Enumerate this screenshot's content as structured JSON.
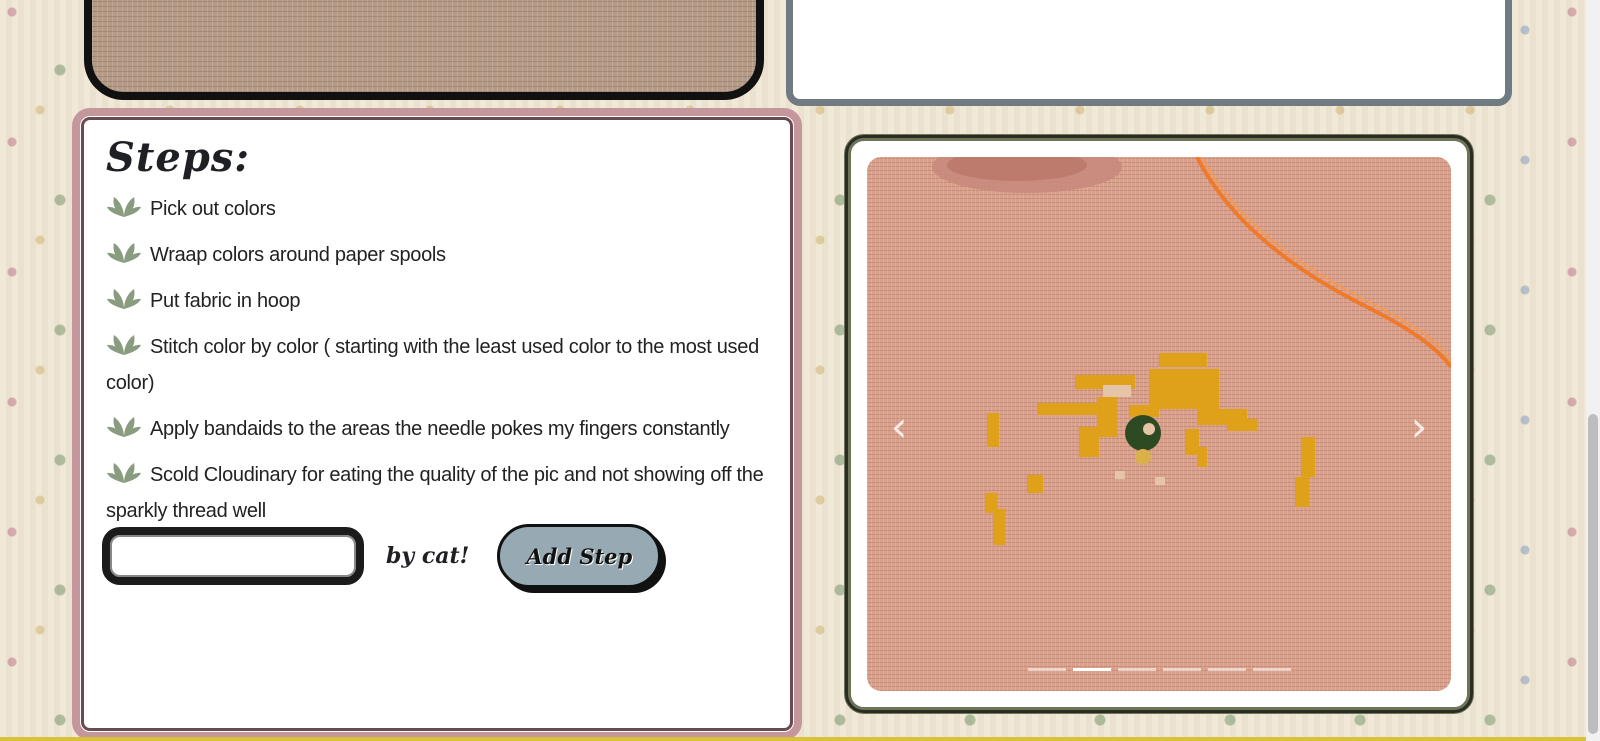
{
  "steps": {
    "title": "Steps:",
    "items": [
      {
        "text": "Pick out colors"
      },
      {
        "text": "Wraap colors around paper spools"
      },
      {
        "text": "Put fabric in hoop"
      },
      {
        "text": "Stitch color by color ( starting with the least used color to the most used color)"
      },
      {
        "text": "Apply bandaids to the areas the needle pokes my fingers constantly"
      },
      {
        "text": "Scold Cloudinary for eating the quality of the pic and not showing off the sparkly thread well"
      }
    ],
    "input_value": "",
    "by_label": "by cat!",
    "add_button_label": "Add Step"
  },
  "carousel": {
    "prev_icon": "chevron-left",
    "next_icon": "chevron-right",
    "slide_count": 6,
    "active_index": 1,
    "image_subject": "cross-stitch-yellow-flower"
  },
  "colors": {
    "steps_border": "#c4979c",
    "carousel_border": "#6d7558",
    "button_bg": "#97a9b2",
    "leaf": "#8a9c80"
  }
}
